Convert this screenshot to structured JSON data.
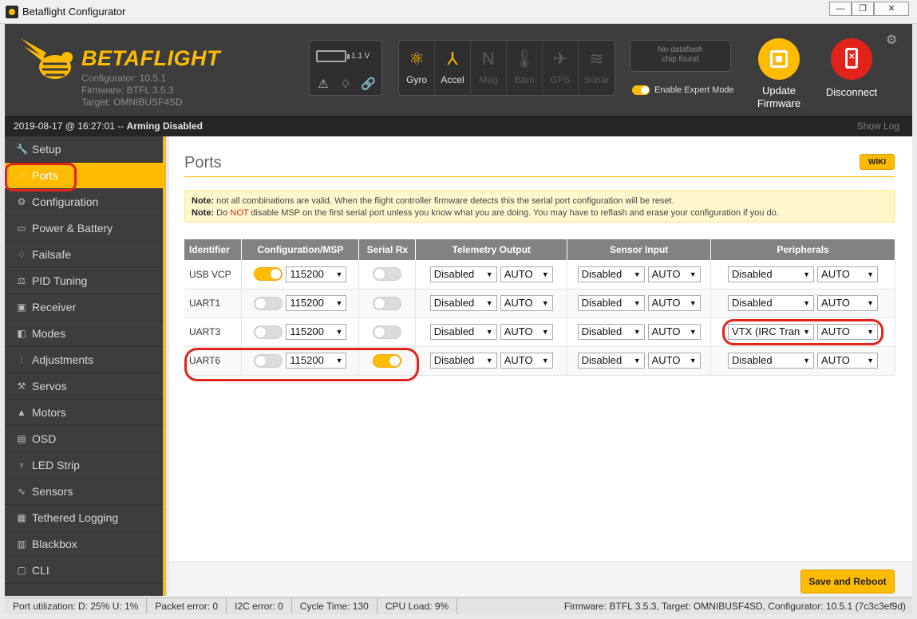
{
  "window": {
    "title": "Betaflight Configurator"
  },
  "header": {
    "logo_text": "BETAFLIGHT",
    "configurator_version": "Configurator: 10.5.1",
    "firmware_version": "Firmware: BTFL 3.5.3",
    "target": "Target: OMNIBUSF4SD",
    "battery_voltage": "1.1 V",
    "sensors": [
      {
        "label": "Gyro",
        "icon": "gyro-icon",
        "active": true
      },
      {
        "label": "Accel",
        "icon": "accel-icon",
        "active": true
      },
      {
        "label": "Mag",
        "icon": "mag-icon",
        "active": false
      },
      {
        "label": "Baro",
        "icon": "baro-icon",
        "active": false
      },
      {
        "label": "GPS",
        "icon": "gps-icon",
        "active": false
      },
      {
        "label": "Sonar",
        "icon": "sonar-icon",
        "active": false
      }
    ],
    "dataflash_line1": "No dataflash",
    "dataflash_line2": "chip found",
    "expert_mode_label": "Enable Expert Mode",
    "update_firmware_line1": "Update",
    "update_firmware_line2": "Firmware",
    "disconnect_label": "Disconnect"
  },
  "statusline": {
    "datetime": "2019-08-17 @ 16:27:01 --",
    "arming": "Arming Disabled",
    "show_log": "Show Log"
  },
  "sidebar": {
    "items": [
      {
        "label": "Setup",
        "icon": "wrench-icon"
      },
      {
        "label": "Ports",
        "icon": "plug-icon"
      },
      {
        "label": "Configuration",
        "icon": "gear-icon"
      },
      {
        "label": "Power & Battery",
        "icon": "battery-icon"
      },
      {
        "label": "Failsafe",
        "icon": "parachute-icon"
      },
      {
        "label": "PID Tuning",
        "icon": "pid-icon"
      },
      {
        "label": "Receiver",
        "icon": "receiver-icon"
      },
      {
        "label": "Modes",
        "icon": "modes-icon"
      },
      {
        "label": "Adjustments",
        "icon": "sliders-icon"
      },
      {
        "label": "Servos",
        "icon": "servo-icon"
      },
      {
        "label": "Motors",
        "icon": "motor-icon"
      },
      {
        "label": "OSD",
        "icon": "osd-icon"
      },
      {
        "label": "LED Strip",
        "icon": "led-icon"
      },
      {
        "label": "Sensors",
        "icon": "pulse-icon"
      },
      {
        "label": "Tethered Logging",
        "icon": "log-icon"
      },
      {
        "label": "Blackbox",
        "icon": "blackbox-icon"
      },
      {
        "label": "CLI",
        "icon": "terminal-icon"
      }
    ],
    "active_index": 1
  },
  "main": {
    "title": "Ports",
    "wiki_label": "WIKI",
    "note1_bold": "Note:",
    "note1_text": " not all combinations are valid. When the flight controller firmware detects this the serial port configuration will be reset.",
    "note2_bold": "Note:",
    "note2_pre": " Do ",
    "note2_red": "NOT",
    "note2_post": " disable MSP on the first serial port unless you know what you are doing. You may have to reflash and erase your configuration if you do.",
    "table": {
      "headers": [
        "Identifier",
        "Configuration/MSP",
        "Serial Rx",
        "Telemetry Output",
        "Sensor Input",
        "Peripherals"
      ],
      "rows": [
        {
          "id": "USB VCP",
          "msp_on": true,
          "msp_baud": "115200",
          "serial_rx": false,
          "telemetry": "Disabled",
          "telemetry_baud": "AUTO",
          "sensor": "Disabled",
          "sensor_baud": "AUTO",
          "peripheral": "Disabled",
          "peripheral_baud": "AUTO"
        },
        {
          "id": "UART1",
          "msp_on": false,
          "msp_baud": "115200",
          "serial_rx": false,
          "telemetry": "Disabled",
          "telemetry_baud": "AUTO",
          "sensor": "Disabled",
          "sensor_baud": "AUTO",
          "peripheral": "Disabled",
          "peripheral_baud": "AUTO"
        },
        {
          "id": "UART3",
          "msp_on": false,
          "msp_baud": "115200",
          "serial_rx": false,
          "telemetry": "Disabled",
          "telemetry_baud": "AUTO",
          "sensor": "Disabled",
          "sensor_baud": "AUTO",
          "peripheral": "VTX (IRC Tran",
          "peripheral_baud": "AUTO"
        },
        {
          "id": "UART6",
          "msp_on": false,
          "msp_baud": "115200",
          "serial_rx": true,
          "telemetry": "Disabled",
          "telemetry_baud": "AUTO",
          "sensor": "Disabled",
          "sensor_baud": "AUTO",
          "peripheral": "Disabled",
          "peripheral_baud": "AUTO"
        }
      ]
    },
    "save_label": "Save and Reboot"
  },
  "statusbar": {
    "port_util": "Port utilization: D: 25% U: 1%",
    "packet_error": "Packet error: 0",
    "i2c_error": "I2C error: 0",
    "cycle_time": "Cycle Time: 130",
    "cpu_load": "CPU Load: 9%",
    "firmware_info": "Firmware: BTFL 3.5.3, Target: OMNIBUSF4SD, Configurator: 10.5.1 (7c3c3ef9d)"
  },
  "colors": {
    "accent": "#ffbb00",
    "annotation": "#e2231a",
    "header_bg": "#3d3d3d"
  }
}
